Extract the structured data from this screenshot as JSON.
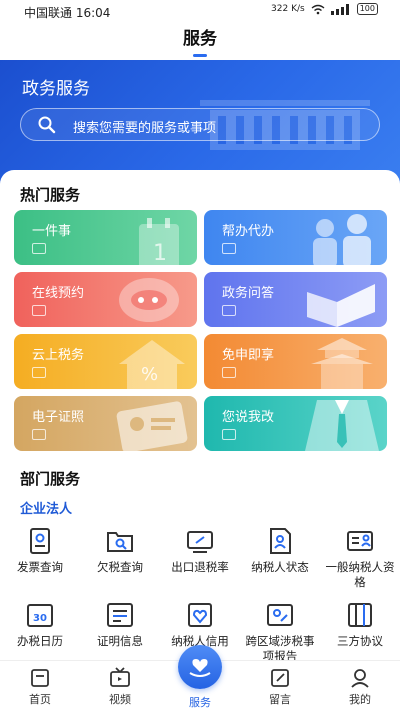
{
  "status": {
    "carrier_time": "中国联通 16:04",
    "net_speed": "322 K/s",
    "battery": "100"
  },
  "header": {
    "title": "服务"
  },
  "hero": {
    "title": "政务服务",
    "search_placeholder": "搜索您需要的服务或事项"
  },
  "hot": {
    "title": "热门服务",
    "tiles": [
      {
        "label": "一件事",
        "color": "#47c38b",
        "icon": "calendar-1-icon"
      },
      {
        "label": "帮办代办",
        "color": "#4a8ff2",
        "icon": "people-icon"
      },
      {
        "label": "在线预约",
        "color": "#f26b5f",
        "icon": "chat-bubble-icon"
      },
      {
        "label": "政务问答",
        "color": "#6b7ef0",
        "icon": "open-book-icon"
      },
      {
        "label": "云上税务",
        "color": "#f7b42e",
        "icon": "house-percent-icon"
      },
      {
        "label": "免申即享",
        "color": "#f5903a",
        "icon": "pagoda-icon"
      },
      {
        "label": "电子证照",
        "color": "#d6aa6a",
        "icon": "id-card-icon"
      },
      {
        "label": "您说我改",
        "color": "#26bdb3",
        "icon": "suit-icon"
      }
    ]
  },
  "dept": {
    "title": "部门服务",
    "subtitle": "企业法人",
    "items": [
      {
        "label": "发票查询",
        "icon": "invoice-icon"
      },
      {
        "label": "欠税查询",
        "icon": "folder-search-icon"
      },
      {
        "label": "出口退税率",
        "icon": "export-rebate-icon"
      },
      {
        "label": "纳税人状态",
        "icon": "taxpayer-status-icon"
      },
      {
        "label": "一般纳税人资格",
        "icon": "qualification-icon"
      },
      {
        "label": "办税日历",
        "icon": "calendar-30-icon"
      },
      {
        "label": "证明信息",
        "icon": "certificate-icon"
      },
      {
        "label": "纳税人信用",
        "icon": "credit-icon"
      },
      {
        "label": "跨区域涉税事项报告",
        "icon": "map-report-icon"
      },
      {
        "label": "三方协议",
        "icon": "agreement-icon"
      }
    ]
  },
  "tabs": [
    {
      "label": "首页",
      "icon": "home-icon"
    },
    {
      "label": "视频",
      "icon": "tv-icon"
    },
    {
      "label": "服务",
      "icon": "heart-hand-icon",
      "active": true
    },
    {
      "label": "留言",
      "icon": "message-edit-icon"
    },
    {
      "label": "我的",
      "icon": "profile-icon"
    }
  ],
  "colors": {
    "brand": "#2a6cf0",
    "accent_text": "#1f5ad6"
  }
}
